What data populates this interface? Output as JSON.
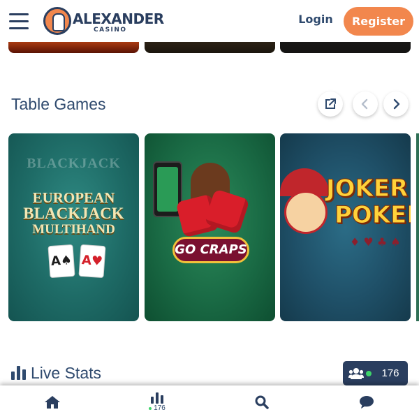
{
  "header": {
    "logo_name": "ALEXANDER",
    "logo_sub": "CASINO",
    "login_label": "Login",
    "register_label": "Register"
  },
  "table_games": {
    "title": "Table Games",
    "games": [
      {
        "faint_title": "BLACKJACK",
        "lines": [
          "EUROPEAN",
          "BLACKJACK",
          "MULTIHAND"
        ],
        "cards": [
          "A♠",
          "A♥"
        ]
      },
      {
        "label": "GO CRAPS"
      },
      {
        "lines": [
          "JOKER",
          "POKER"
        ],
        "suits": "♦ ♥ ♣ ♠"
      }
    ]
  },
  "live_stats": {
    "title": "Live Stats",
    "players_online": "176"
  },
  "bottom_nav": {
    "stats_count": "176"
  },
  "colors": {
    "brand_navy": "#2a3e5f",
    "accent_orange": "#f2874d",
    "online_green": "#3ed46a"
  },
  "icons": [
    "menu-icon",
    "external-link-icon",
    "chevron-left-icon",
    "chevron-right-icon",
    "bar-chart-icon",
    "users-icon",
    "home-icon",
    "search-icon",
    "chat-icon"
  ]
}
